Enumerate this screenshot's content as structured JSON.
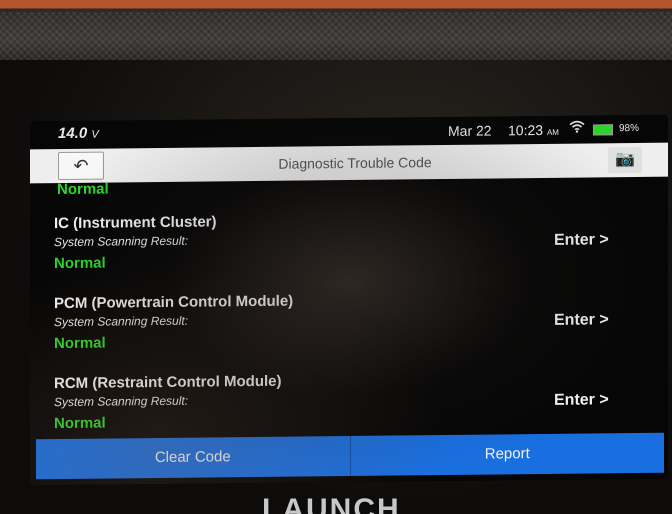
{
  "status_bar": {
    "voltage": "14.0",
    "voltage_unit": "V",
    "date": "Mar 22",
    "time": "10:23",
    "ampm": "AM",
    "battery_percent": "98%",
    "icons": [
      "battery-voltage-icon",
      "wifi-icon",
      "battery-icon"
    ]
  },
  "header": {
    "title": "Diagnostic Trouble Code",
    "back_icon": "back-arrow-icon",
    "camera_icon": "camera-icon"
  },
  "partial_item": {
    "status": "Normal"
  },
  "modules": [
    {
      "name": "IC (Instrument Cluster)",
      "label": "System Scanning Result:",
      "status": "Normal",
      "action": "Enter >"
    },
    {
      "name": "PCM (Powertrain Control Module)",
      "label": "System Scanning Result:",
      "status": "Normal",
      "action": "Enter >"
    },
    {
      "name": "RCM (Restraint Control Module)",
      "label": "System Scanning Result:",
      "status": "Normal",
      "action": "Enter >"
    }
  ],
  "bottom_bar": {
    "clear_code": "Clear Code",
    "report": "Report"
  },
  "device": {
    "brand": "LAUNCH"
  },
  "colors": {
    "accent_blue": "#1a6fe0",
    "normal_green": "#2dd62d",
    "battery_green": "#2bd32b"
  }
}
